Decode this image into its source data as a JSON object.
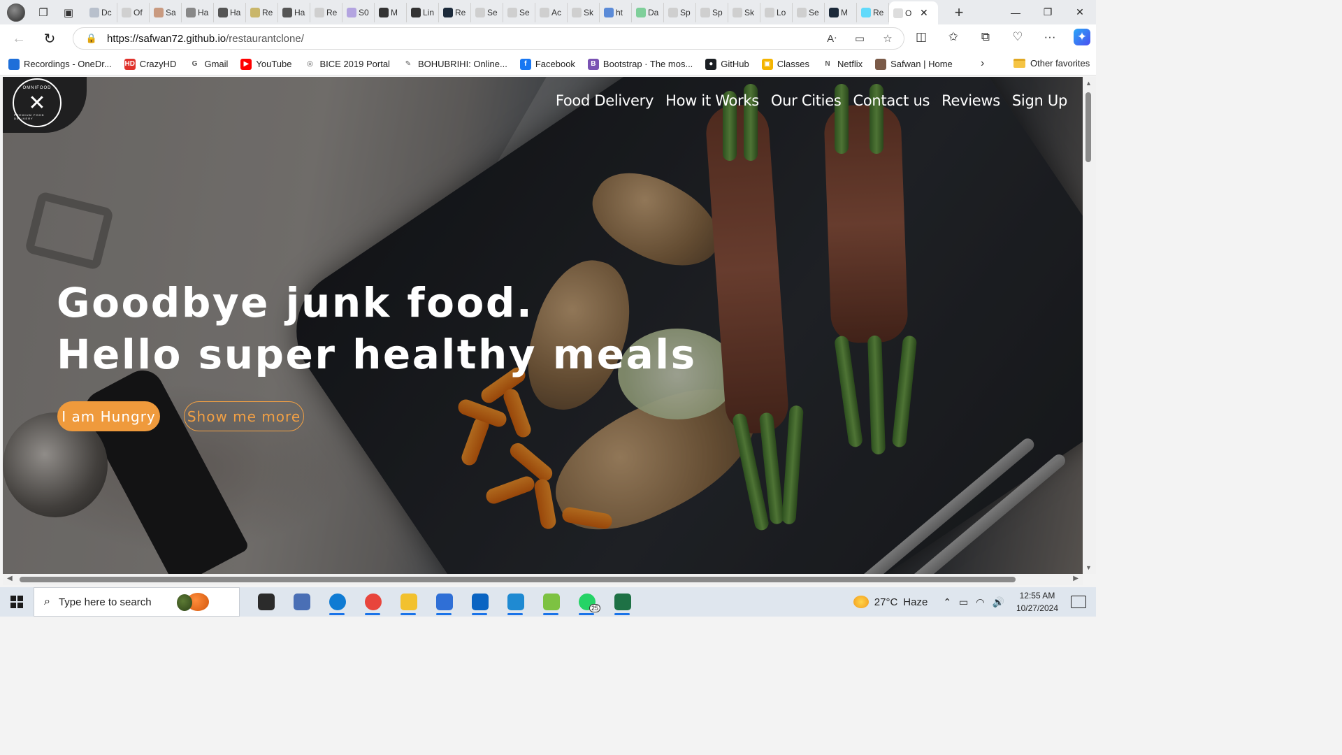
{
  "browser": {
    "tabs": [
      {
        "title": "Dc",
        "color": "#b8c0cc"
      },
      {
        "title": "Of",
        "color": "#d0d0d0"
      },
      {
        "title": "Sa",
        "color": "#c99a80"
      },
      {
        "title": "Ha",
        "color": "#888888"
      },
      {
        "title": "Ha",
        "color": "#555555"
      },
      {
        "title": "Re",
        "color": "#c9b66a"
      },
      {
        "title": "Ha",
        "color": "#555555"
      },
      {
        "title": "Re",
        "color": "#cfcfcf"
      },
      {
        "title": "S0",
        "color": "#b3a4e0"
      },
      {
        "title": "M",
        "color": "#333333"
      },
      {
        "title": "Lin",
        "color": "#333333"
      },
      {
        "title": "Re",
        "color": "#1c2a3a"
      },
      {
        "title": "Se",
        "color": "#cfcfcf"
      },
      {
        "title": "Se",
        "color": "#cfcfcf"
      },
      {
        "title": "Ac",
        "color": "#cfcfcf"
      },
      {
        "title": "Sk",
        "color": "#cfcfcf"
      },
      {
        "title": "ht",
        "color": "#5b8bd8"
      },
      {
        "title": "Da",
        "color": "#7fcf9a"
      },
      {
        "title": "Sp",
        "color": "#cfcfcf"
      },
      {
        "title": "Sp",
        "color": "#cfcfcf"
      },
      {
        "title": "Sk",
        "color": "#cfcfcf"
      },
      {
        "title": "Lo",
        "color": "#cfcfcf"
      },
      {
        "title": "Se",
        "color": "#cfcfcf"
      },
      {
        "title": "M",
        "color": "#1c2a3a"
      },
      {
        "title": "Re",
        "color": "#61dafb"
      }
    ],
    "active_tab": {
      "title": "O",
      "color": "#ffffff"
    },
    "url_domain": "https://safwan72.github.io",
    "url_path": "/restaurantclone/",
    "bookmarks": [
      {
        "label": "Recordings - OneDr...",
        "color": "#1e6fd9",
        "glyph": ""
      },
      {
        "label": "CrazyHD",
        "color": "#e0322c",
        "glyph": "HD"
      },
      {
        "label": "Gmail",
        "color": "#ffffff",
        "glyph": "G"
      },
      {
        "label": "YouTube",
        "color": "#ff0000",
        "glyph": "▶"
      },
      {
        "label": "BICE 2019 Portal",
        "color": "#ffffff",
        "glyph": "◎"
      },
      {
        "label": "BOHUBRIHI: Online...",
        "color": "#ffffff",
        "glyph": "✎"
      },
      {
        "label": "Facebook",
        "color": "#1877f2",
        "glyph": "f"
      },
      {
        "label": "Bootstrap · The mos...",
        "color": "#7952b3",
        "glyph": "B"
      },
      {
        "label": "GitHub",
        "color": "#1b1f23",
        "glyph": "●"
      },
      {
        "label": "Classes",
        "color": "#f4b400",
        "glyph": "▣"
      },
      {
        "label": "Netflix",
        "color": "#ffffff",
        "glyph": "N"
      },
      {
        "label": "Safwan | Home",
        "color": "#7a5a48",
        "glyph": ""
      }
    ],
    "other_favorites": "Other favorites"
  },
  "site": {
    "logo_text_top": "OMNIFOOD",
    "logo_text_bottom": "PREMIUM FOOD DELIVERY",
    "nav": [
      "Food Delivery",
      "How it Works",
      "Our Cities",
      "Contact us",
      "Reviews",
      "Sign Up"
    ],
    "hero_line1": "Goodbye junk food.",
    "hero_line2": "Hello super healthy meals",
    "btn_primary": "I am Hungry",
    "btn_secondary": "Show me more",
    "accent_color": "#ef9a3c"
  },
  "taskbar": {
    "search_placeholder": "Type here to search",
    "apps": [
      {
        "name": "task-view",
        "color": "#2b2b2b"
      },
      {
        "name": "people",
        "color": "#4a6fb5"
      },
      {
        "name": "edge",
        "color": "#0f7bd3"
      },
      {
        "name": "chrome",
        "color": "#e8453c"
      },
      {
        "name": "file-explorer",
        "color": "#f2c12e"
      },
      {
        "name": "store",
        "color": "#2f6fd6"
      },
      {
        "name": "outlook",
        "color": "#0a64c2"
      },
      {
        "name": "vscode",
        "color": "#1f8ad2"
      },
      {
        "name": "snip",
        "color": "#7dc242"
      },
      {
        "name": "whatsapp",
        "color": "#25d366"
      },
      {
        "name": "excel",
        "color": "#1e7145"
      }
    ],
    "whatsapp_badge": "25",
    "weather_temp": "27°C",
    "weather_desc": "Haze",
    "time": "12:55 AM",
    "date": "10/27/2024"
  }
}
